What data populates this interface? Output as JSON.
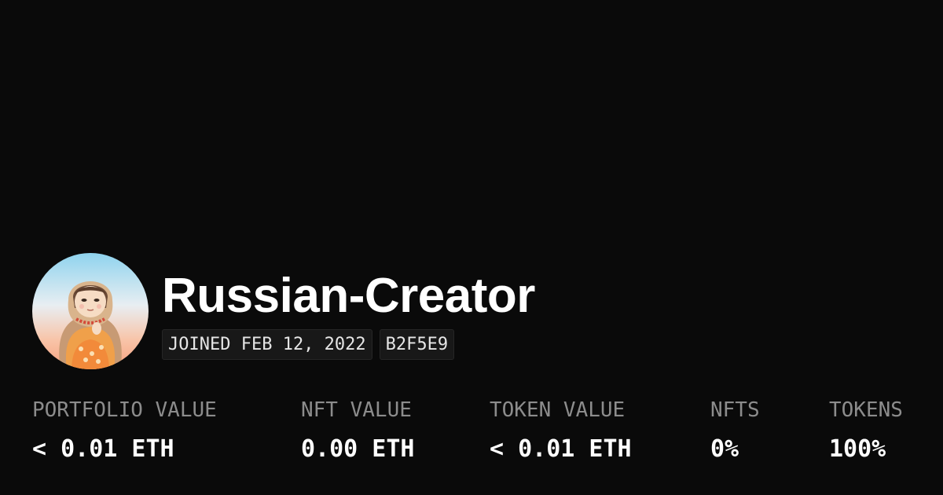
{
  "profile": {
    "name": "Russian-Creator",
    "joined": "JOINED FEB 12, 2022",
    "code": "B2F5E9",
    "avatar_icon": "matryoshka-doll-avatar"
  },
  "stats": [
    {
      "label": "PORTFOLIO VALUE",
      "value": "< 0.01 ETH"
    },
    {
      "label": "NFT VALUE",
      "value": "0.00 ETH"
    },
    {
      "label": "TOKEN VALUE",
      "value": "< 0.01 ETH"
    },
    {
      "label": "NFTS",
      "value": "0%"
    },
    {
      "label": "TOKENS",
      "value": "100%"
    }
  ],
  "colors": {
    "background": "#0a0a0a",
    "text": "#ffffff",
    "muted": "#8c8c8c",
    "badge_bg": "#181818"
  }
}
